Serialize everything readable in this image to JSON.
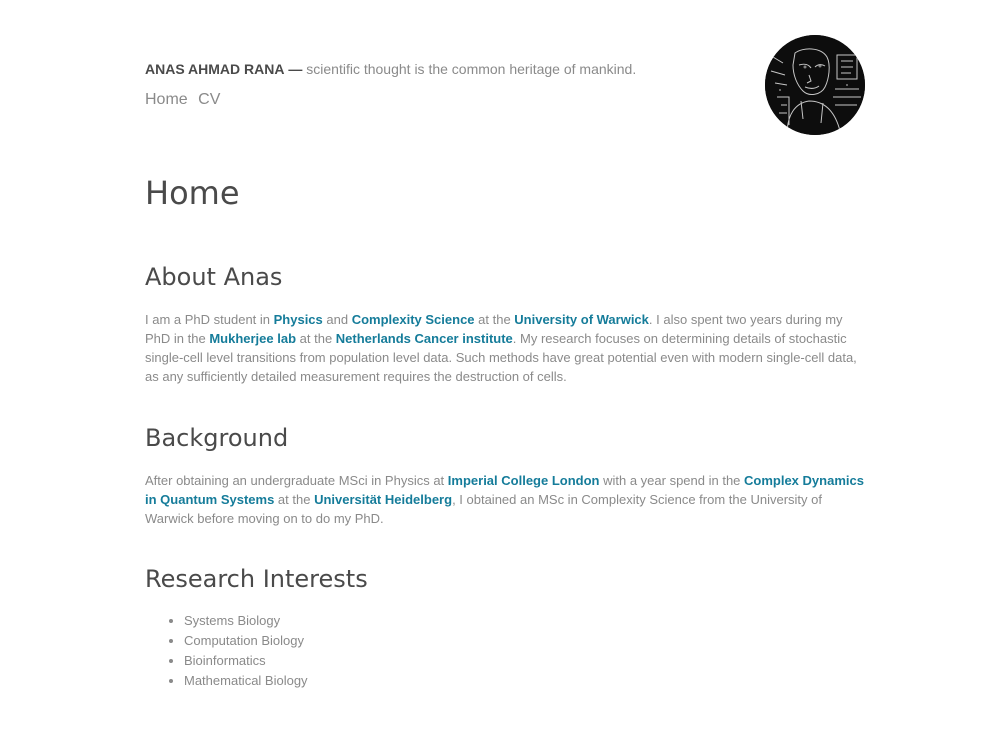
{
  "header": {
    "name": "ANAS AHMAD RANA",
    "dash": "—",
    "tagline": "scientific thought is the common heritage of mankind."
  },
  "nav": {
    "home": "Home",
    "cv": "CV"
  },
  "page": {
    "title": "Home"
  },
  "about": {
    "heading": "About Anas",
    "t1": "I am a PhD student in ",
    "link_physics": "Physics",
    "t2": " and ",
    "link_complexity": "Complexity Science",
    "t3": " at the ",
    "link_warwick": "University of Warwick",
    "t4": ". I also spent two years during my PhD in the ",
    "link_mukherjee": "Mukherjee lab",
    "t5": " at the ",
    "link_nki": "Netherlands Cancer institute",
    "t6": ". My research focuses on determining details of stochastic single-cell level transitions from population level data. Such methods have great potential even with modern single-cell data, as any sufficiently detailed measurement requires the destruction of cells."
  },
  "background": {
    "heading": "Background",
    "t1": "After obtaining an undergraduate MSci in Physics at ",
    "link_imperial": "Imperial College London",
    "t2": " with a year spend in the ",
    "link_cdqs": "Complex Dynamics in Quantum Systems",
    "t3": " at the ",
    "link_heidelberg": "Universität Heidelberg",
    "t4": ", I obtained an MSc in Complexity Science from the University of Warwick before moving on to do my PhD."
  },
  "interests": {
    "heading": "Research Interests",
    "items": [
      "Systems Biology",
      "Computation Biology",
      "Bioinformatics",
      "Mathematical Biology"
    ]
  },
  "avatar": {
    "icon": "portrait-photo"
  }
}
